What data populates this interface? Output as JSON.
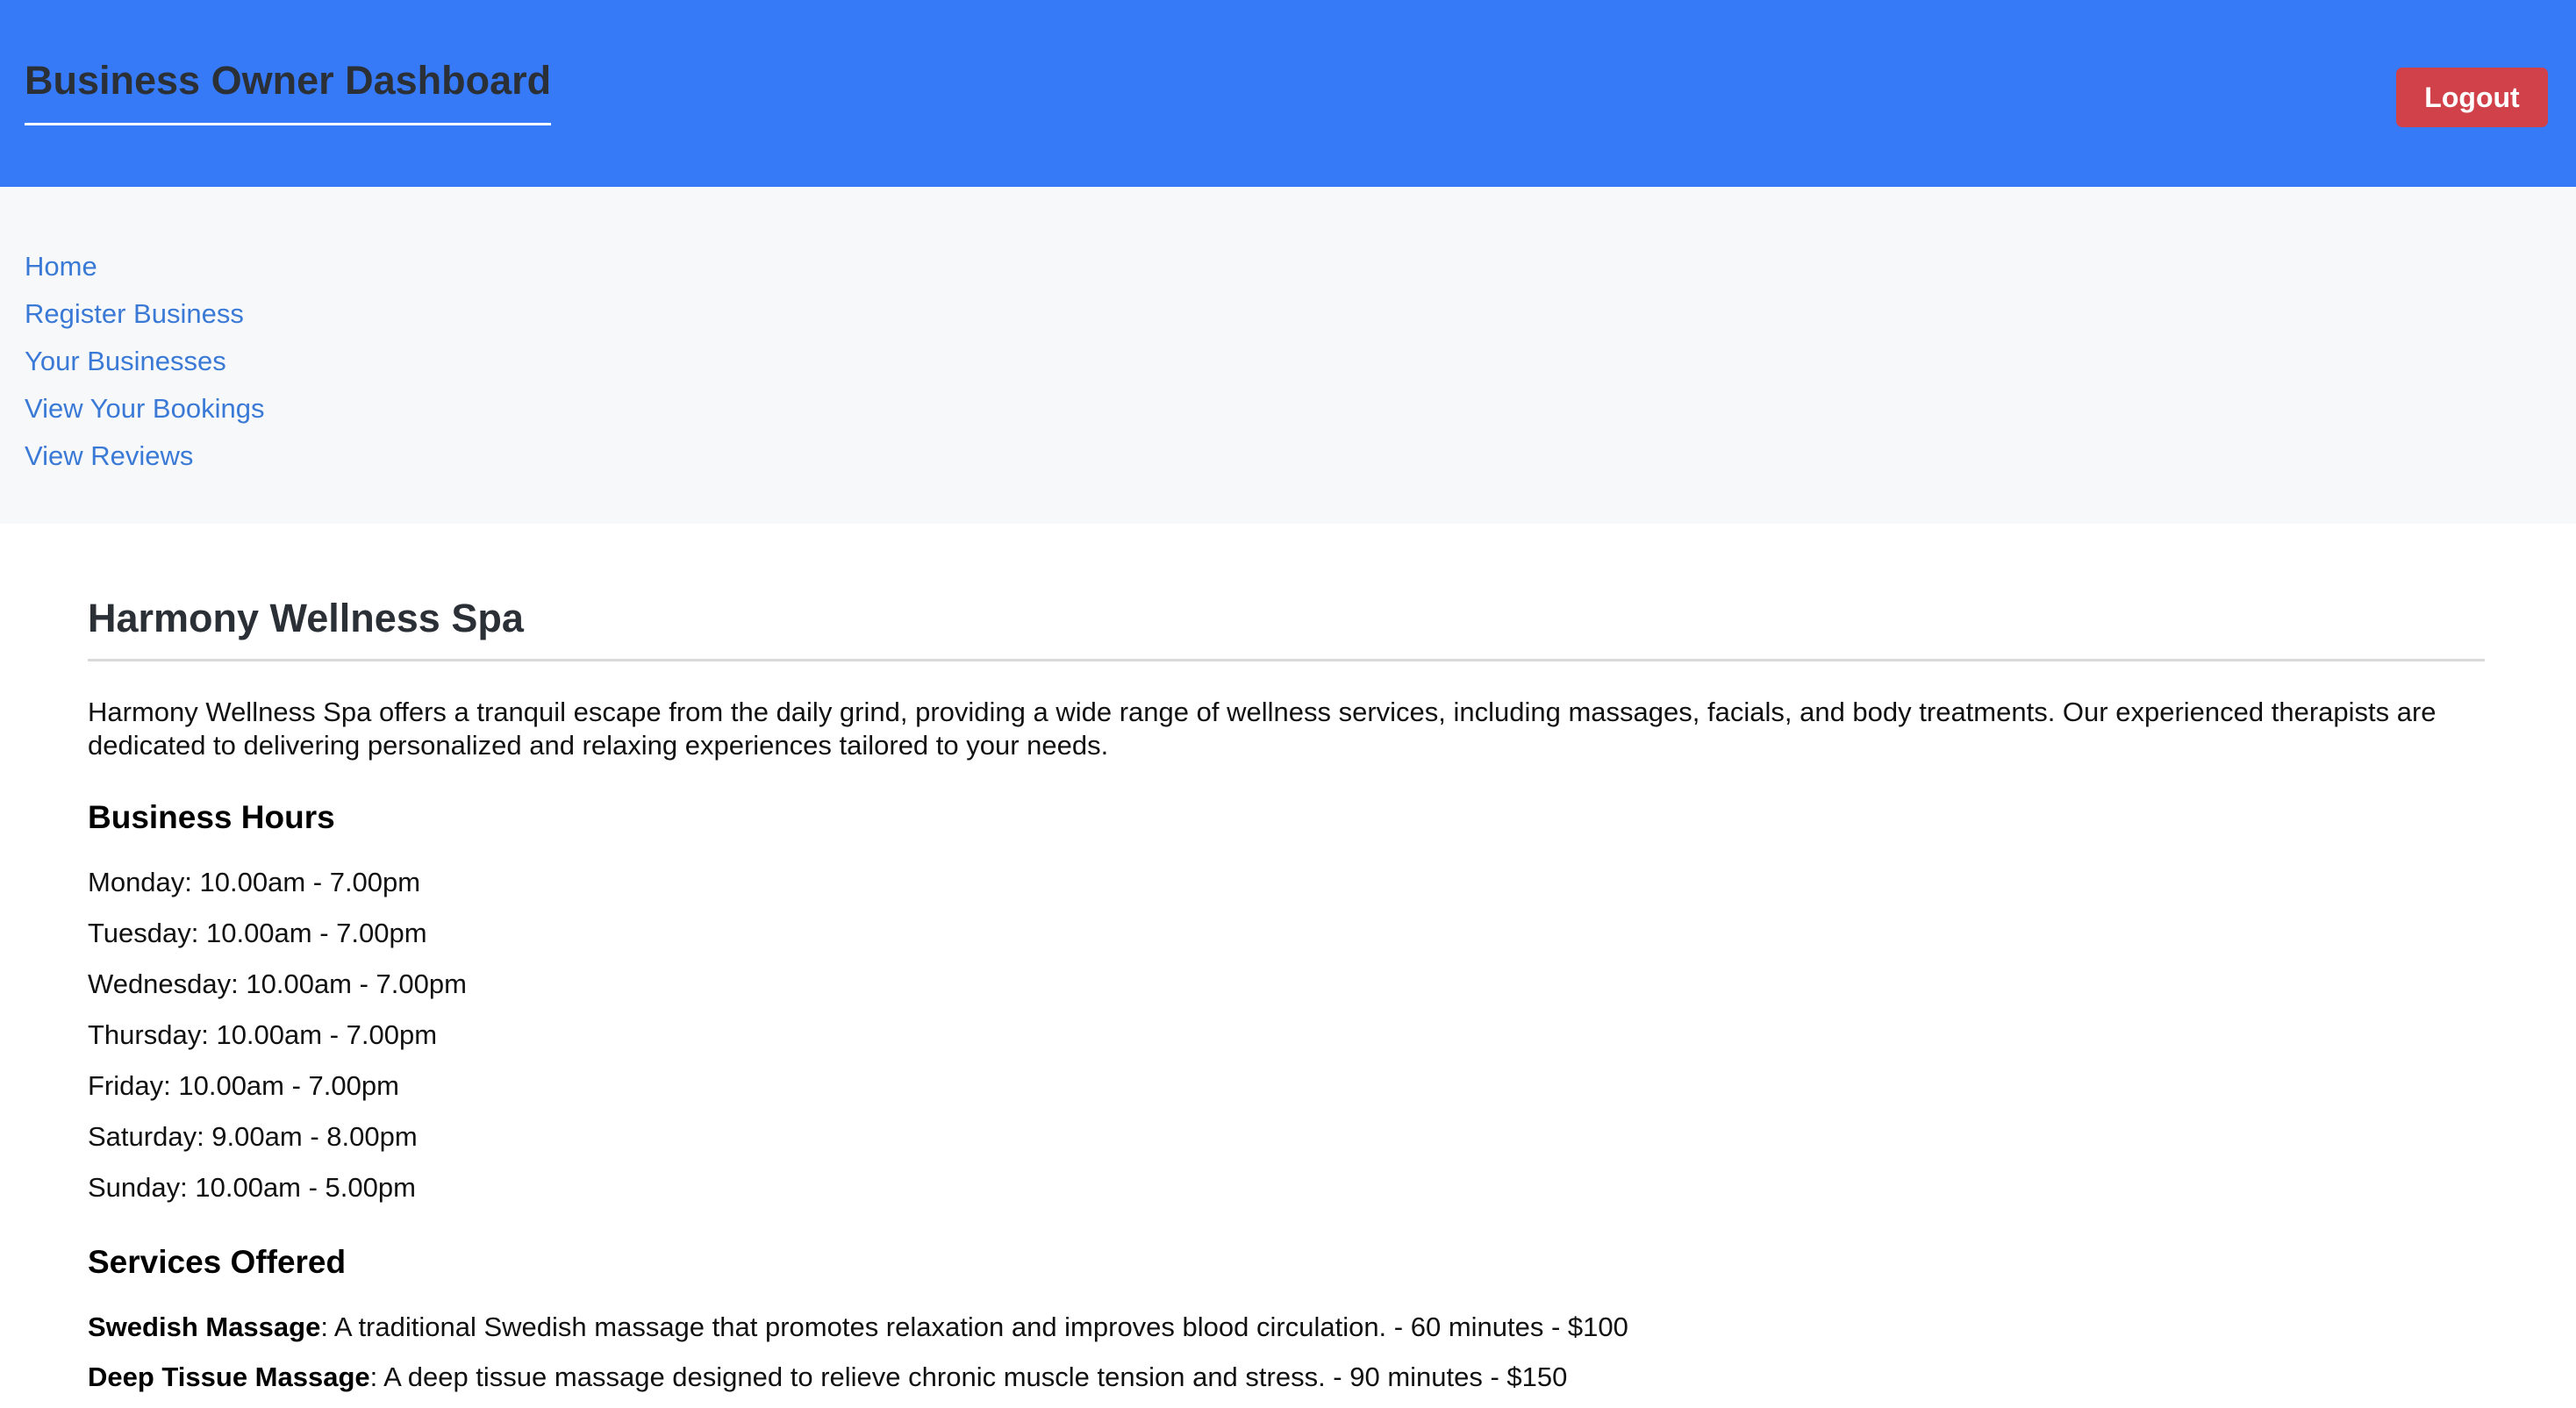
{
  "header": {
    "title": "Business Owner Dashboard",
    "logout_label": "Logout"
  },
  "nav": {
    "items": [
      {
        "label": "Home"
      },
      {
        "label": "Register Business"
      },
      {
        "label": "Your Businesses"
      },
      {
        "label": "View Your Bookings"
      },
      {
        "label": "View Reviews"
      }
    ]
  },
  "business": {
    "name": "Harmony Wellness Spa",
    "description": "Harmony Wellness Spa offers a tranquil escape from the daily grind, providing a wide range of wellness services, including massages, facials, and body treatments. Our experienced therapists are dedicated to delivering personalized and relaxing experiences tailored to your needs.",
    "hours_heading": "Business Hours",
    "hours": [
      "Monday: 10.00am - 7.00pm",
      "Tuesday: 10.00am - 7.00pm",
      "Wednesday: 10.00am - 7.00pm",
      "Thursday: 10.00am - 7.00pm",
      "Friday: 10.00am - 7.00pm",
      "Saturday: 9.00am - 8.00pm",
      "Sunday: 10.00am - 5.00pm"
    ],
    "services_heading": "Services Offered",
    "services": [
      {
        "name": "Swedish Massage",
        "detail": ": A traditional Swedish massage that promotes relaxation and improves blood circulation. - 60 minutes - $100"
      },
      {
        "name": "Deep Tissue Massage",
        "detail": ": A deep tissue massage designed to relieve chronic muscle tension and stress. - 90 minutes - $150"
      }
    ]
  },
  "colors": {
    "header_bg": "#377af7",
    "logout_bg": "#d0414a",
    "nav_bg": "#f7f8fa",
    "link": "#3a7ad6"
  }
}
